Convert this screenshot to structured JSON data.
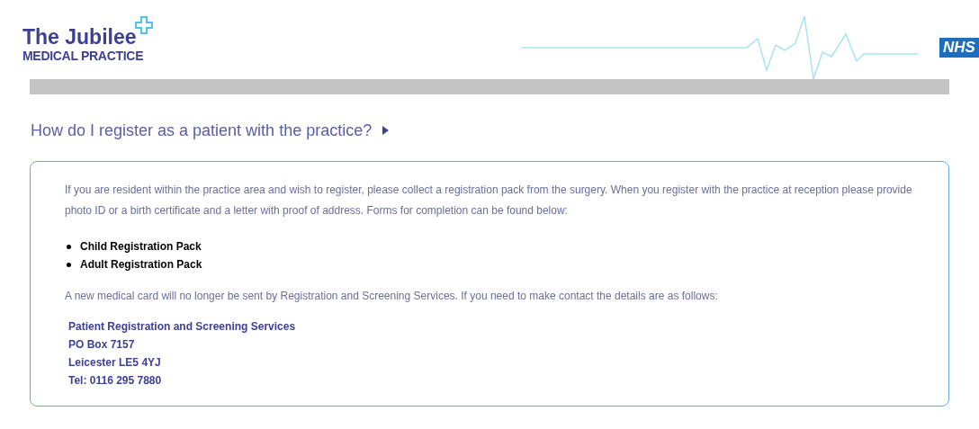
{
  "header": {
    "logo_title": "The Jubilee",
    "logo_subtitle": "MEDICAL PRACTICE",
    "badge": "NHS"
  },
  "question": {
    "title": "How do I register as a patient with the practice?",
    "expanded": true
  },
  "answer": {
    "intro": "If you are resident within the practice area and wish to register, please collect a registration pack from the surgery. When you register with the practice at reception please provide photo ID or a birth certificate and a letter with proof of address. Forms for completion can be found below:",
    "links": [
      "Child Registration Pack",
      "Adult Registration Pack"
    ],
    "note": "A new medical card will no longer be sent by Registration and Screening Services. If you need to make contact the details are as follows:",
    "address": [
      "Patient Registration and Screening Services",
      "PO Box 7157",
      "Leicester LE5 4YJ",
      "Tel: 0116 295 7880"
    ]
  }
}
